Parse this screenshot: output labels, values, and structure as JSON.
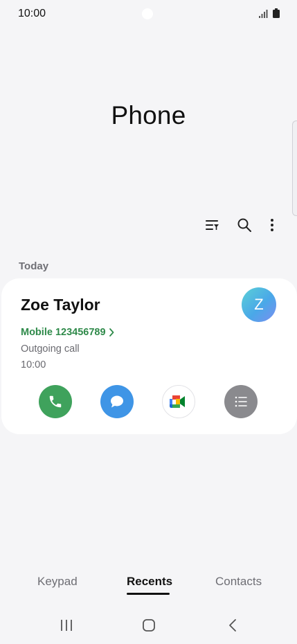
{
  "status_bar": {
    "time": "10:00"
  },
  "app": {
    "title": "Phone"
  },
  "section": {
    "label": "Today"
  },
  "call": {
    "name": "Zoe Taylor",
    "avatar_letter": "Z",
    "number_label": "Mobile 123456789",
    "type": "Outgoing call",
    "time": "10:00"
  },
  "tabs": {
    "keypad": "Keypad",
    "recents": "Recents",
    "contacts": "Contacts"
  },
  "colors": {
    "accent_green": "#3fa25c",
    "link_green": "#2f8a4a",
    "message_blue": "#3f95e6",
    "details_gray": "#8a8a8e"
  }
}
